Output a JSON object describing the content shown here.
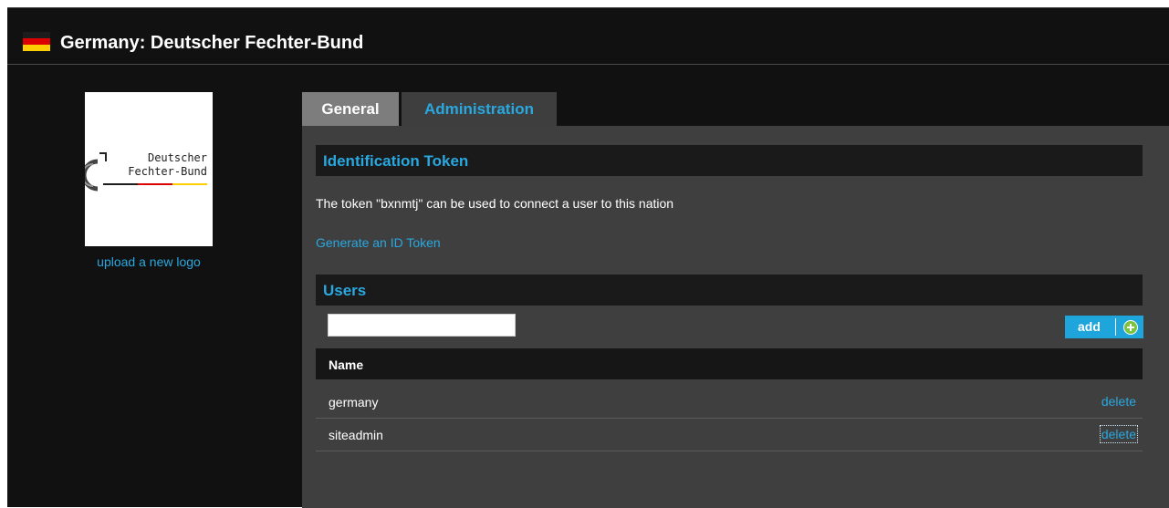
{
  "header": {
    "title": "Germany: Deutscher Fechter-Bund",
    "flag_colors": [
      "#1c1c1c",
      "#dd0000",
      "#ffce00"
    ]
  },
  "logo": {
    "line1": "Deutscher",
    "line2": "Fechter-Bund",
    "upload_label": "upload a new logo"
  },
  "tabs": [
    {
      "label": "General",
      "active": false
    },
    {
      "label": "Administration",
      "active": true
    }
  ],
  "identification": {
    "title": "Identification Token",
    "text": "The token \"bxnmtj\" can be used to connect a user to this nation",
    "generate_label": "Generate an ID Token"
  },
  "users": {
    "title": "Users",
    "input_value": "",
    "add_label": "add",
    "column_name": "Name",
    "rows": [
      {
        "name": "germany",
        "action": "delete"
      },
      {
        "name": "siteadmin",
        "action": "delete"
      }
    ]
  },
  "colors": {
    "accent": "#29a8e0",
    "add_button": "#1ea6dc",
    "plus_icon": "#7dc242"
  }
}
